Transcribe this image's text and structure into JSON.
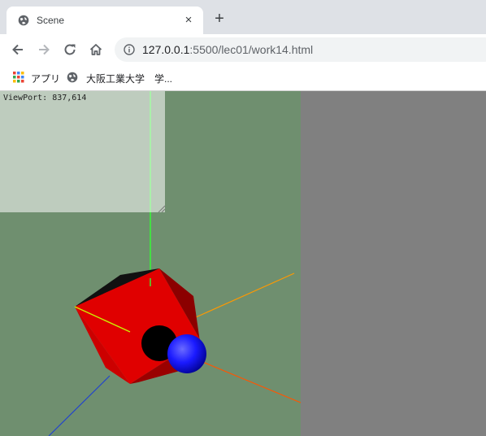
{
  "browser": {
    "tab": {
      "title": "Scene",
      "close_glyph": "×",
      "favicon": "globe-icon"
    },
    "new_tab_glyph": "+",
    "toolbar": {
      "back_icon": "arrow-left-icon",
      "forward_icon": "arrow-right-icon",
      "reload_icon": "reload-icon",
      "home_icon": "home-icon",
      "url_host": "127.0.0.1",
      "url_path": ":5500/lec01/work14.html"
    },
    "bookmarks": [
      {
        "label": "アプリ",
        "icon": "apps-grid-icon"
      },
      {
        "label": "大阪工業大学",
        "icon": "globe-icon"
      },
      {
        "label": "学...",
        "icon": ""
      }
    ]
  },
  "page": {
    "viewport_label": "ViewPort: 837,614",
    "canvas_background": "#6f8f6f",
    "page_background": "#808080",
    "colors": {
      "cube": "#dd0000",
      "sphere_blue": "#1a1aff",
      "sphere_black": "#000000",
      "axis_x": "#ff5500",
      "axis_y": "#33ff33",
      "axis_z": "#2244cc",
      "axis_orange": "#ff9900",
      "axis_yellow": "#ccee00"
    }
  }
}
